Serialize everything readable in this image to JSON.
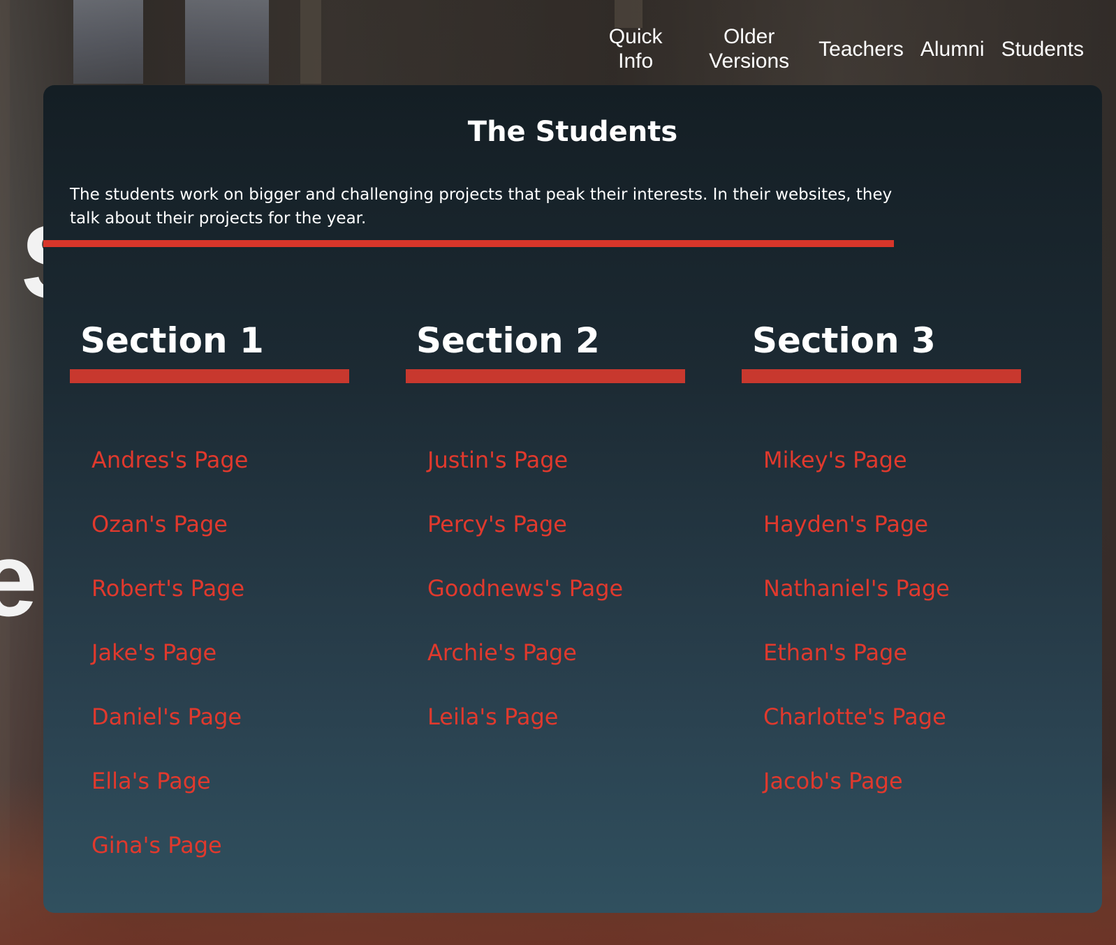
{
  "nav": {
    "items": [
      {
        "label_line1": "Quick",
        "label_line2": "Info"
      },
      {
        "label_line1": "Older",
        "label_line2": "Versions"
      },
      {
        "label": "Teachers"
      },
      {
        "label": "Alumni"
      },
      {
        "label": "Students"
      }
    ]
  },
  "panel": {
    "title": "The Students",
    "description": "The students work on bigger and challenging projects that peak their interests. In their websites, they talk about their projects for the year.",
    "sections": [
      {
        "heading": "Section 1",
        "links": [
          "Andres's Page",
          "Ozan's Page",
          "Robert's Page",
          "Jake's Page",
          "Daniel's Page",
          "Ella's Page",
          "Gina's Page"
        ]
      },
      {
        "heading": "Section 2",
        "links": [
          "Justin's Page",
          "Percy's Page",
          "Goodnews's Page",
          "Archie's Page",
          "Leila's Page"
        ]
      },
      {
        "heading": "Section 3",
        "links": [
          "Mikey's Page",
          "Hayden's Page",
          "Nathaniel's Page",
          "Ethan's Page",
          "Charlotte's Page",
          "Jacob's Page"
        ]
      }
    ]
  },
  "colors": {
    "accent": "#d8362a",
    "link": "#e0392d",
    "panel_top": "#141e24",
    "panel_bottom": "#30505f"
  }
}
